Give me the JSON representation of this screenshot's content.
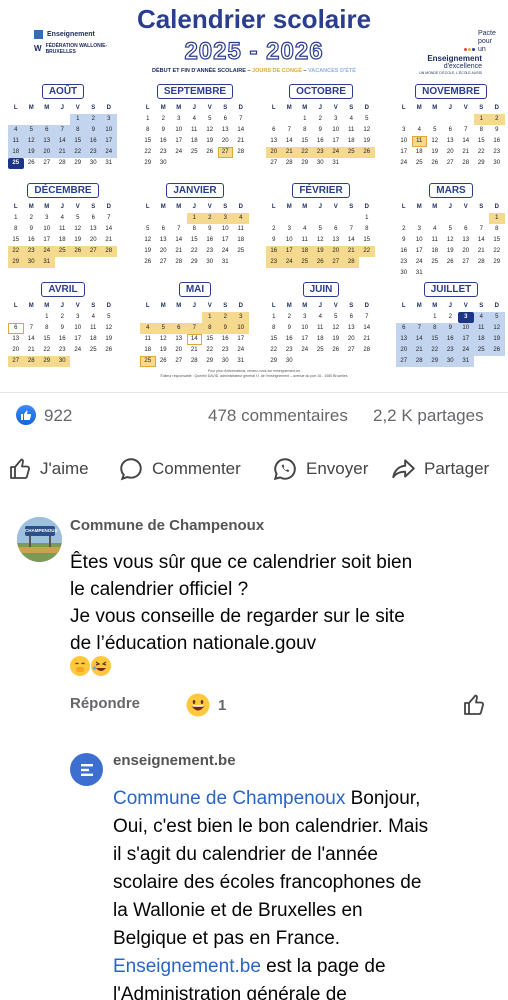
{
  "post_image": {
    "title": "Calendrier scolaire",
    "years": "2025 - 2026",
    "legend": {
      "dates": "DÉBUT ET FIN D'ANNÉE SCOLAIRE",
      "sep1": " – ",
      "conge": "JOURS DE CONGÉ",
      "sep2": " – ",
      "ete": "VACANCES D'ÉTÉ"
    },
    "logo_left_1": "Enseignement",
    "logo_left_2": "FÉDÉRATION WALLONIE-BRUXELLES",
    "logo_right_1": "Pacte pour un",
    "logo_right_2": "Enseignement",
    "logo_right_3": "d'excellence",
    "logo_right_4": "UN MONDE D'ÉCOLE, L'ÉCOLE AUSSI",
    "footer_1": "Pour plus d'informations, rendez-vous sur enseignement.be",
    "footer_2": "Éditeur responsable : Quentin DAVID, administrateur général f.f. de l'enseignement – avenue du port 16 - 1080 Bruxelles",
    "weekday_headers": [
      "L",
      "M",
      "M",
      "J",
      "V",
      "S",
      "D"
    ],
    "months": [
      {
        "name": "AOÛT",
        "offset": 4,
        "days": 31,
        "v": [
          1,
          2,
          3,
          4,
          5,
          6,
          7,
          8,
          9,
          10,
          11,
          12,
          13,
          14,
          15,
          16,
          17,
          18,
          19,
          20,
          21,
          22,
          23,
          24
        ],
        "c": [],
        "s": [
          25
        ],
        "o": []
      },
      {
        "name": "SEPTEMBRE",
        "offset": 0,
        "days": 30,
        "v": [],
        "c": [
          27
        ],
        "s": [],
        "o": [
          27
        ]
      },
      {
        "name": "OCTOBRE",
        "offset": 2,
        "days": 31,
        "v": [],
        "c": [
          20,
          21,
          22,
          23,
          24,
          25,
          26
        ],
        "s": [],
        "o": []
      },
      {
        "name": "NOVEMBRE",
        "offset": 5,
        "days": 30,
        "v": [],
        "c": [
          1,
          2,
          11
        ],
        "s": [],
        "o": [
          11
        ]
      },
      {
        "name": "DÉCEMBRE",
        "offset": 0,
        "days": 31,
        "v": [],
        "c": [
          22,
          23,
          24,
          25,
          26,
          27,
          28,
          29,
          30,
          31
        ],
        "s": [],
        "o": []
      },
      {
        "name": "JANVIER",
        "offset": 3,
        "days": 31,
        "v": [],
        "c": [
          1,
          2,
          3,
          4
        ],
        "s": [],
        "o": []
      },
      {
        "name": "FÉVRIER",
        "offset": 6,
        "days": 28,
        "v": [],
        "c": [
          16,
          17,
          18,
          19,
          20,
          21,
          22,
          23,
          24,
          25,
          26,
          27,
          28
        ],
        "s": [],
        "o": []
      },
      {
        "name": "MARS",
        "offset": 6,
        "days": 31,
        "v": [],
        "c": [
          1
        ],
        "s": [],
        "o": []
      },
      {
        "name": "AVRIL",
        "offset": 2,
        "days": 30,
        "v": [],
        "c": [
          27,
          28,
          29,
          30
        ],
        "s": [],
        "o": [
          6
        ]
      },
      {
        "name": "MAI",
        "offset": 4,
        "days": 31,
        "v": [],
        "c": [
          1,
          2,
          3,
          4,
          5,
          6,
          7,
          8,
          9,
          10,
          25
        ],
        "s": [],
        "o": [
          14,
          25
        ]
      },
      {
        "name": "JUIN",
        "offset": 0,
        "days": 30,
        "v": [],
        "c": [],
        "s": [],
        "o": []
      },
      {
        "name": "JUILLET",
        "offset": 2,
        "days": 31,
        "v": [
          4,
          5,
          6,
          7,
          8,
          9,
          10,
          11,
          12,
          13,
          14,
          15,
          16,
          17,
          18,
          19,
          20,
          21,
          22,
          23,
          24,
          25,
          26,
          27,
          28,
          29,
          30,
          31
        ],
        "c": [],
        "s": [
          3
        ],
        "o": []
      }
    ]
  },
  "stats": {
    "likes": "922",
    "comments": "478 commentaires",
    "shares": "2,2 K partages"
  },
  "actions": {
    "like": "J'aime",
    "comment": "Commenter",
    "send": "Envoyer",
    "share": "Partager"
  },
  "comment1": {
    "author": "Commune de Champenoux",
    "avatar_sign": "CHAMPENOUX",
    "line1": "Êtes vous sûr que ce calendrier soit bien",
    "line2": "le calendrier officiel ?",
    "line3": "Je vous conseille de regarder sur le site",
    "line4": "de l’éducation nationale.gouv",
    "reply_label": "Répondre",
    "reaction_count": "1"
  },
  "reply": {
    "author": "enseignement.be",
    "mention": "Commune de Champenoux",
    "line1_rest": " Bonjour,",
    "line2": "Oui, c'est bien le bon calendrier. Mais",
    "line3": "il s'agit du calendrier de l'année",
    "line4": "scolaire des écoles francophones de",
    "line5": "la Wallonie et de Bruxelles en",
    "line6": "Belgique et pas en France.",
    "link": "Enseignement.be",
    "line7_rest": " est la page de",
    "line8": "l'Administration générale de"
  },
  "colors": {
    "navy": "#2a3d8f",
    "summer": "#c3d5ee",
    "holiday": "#f4d98e",
    "fb_blue": "#1565d8",
    "mention": "#2a65c4"
  }
}
